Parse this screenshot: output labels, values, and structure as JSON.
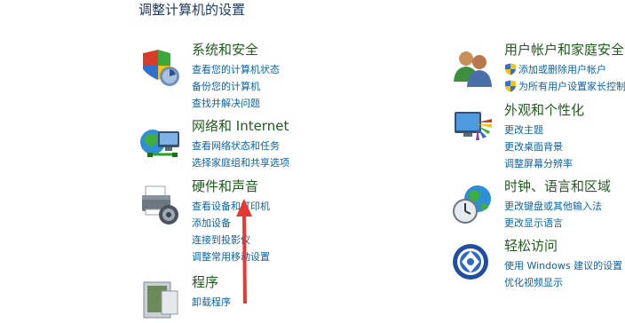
{
  "page": {
    "title": "调整计算机的设置"
  },
  "categories": [
    {
      "heading": "系统和安全",
      "links": [
        "查看您的计算机状态",
        "备份您的计算机",
        "查找并解决问题"
      ]
    },
    {
      "heading": "网络和 Internet",
      "links": [
        "查看网络状态和任务",
        "选择家庭组和共享选项"
      ]
    },
    {
      "heading": "硬件和声音",
      "links": [
        "查看设备和打印机",
        "添加设备",
        "连接到投影仪",
        "调整常用移动设置"
      ]
    },
    {
      "heading": "程序",
      "links": [
        "卸载程序"
      ]
    },
    {
      "heading": "用户帐户和家庭安全",
      "links": [
        "添加或删除用户帐户",
        "为所有用户设置家长控制"
      ]
    },
    {
      "heading": "外观和个性化",
      "links": [
        "更改主题",
        "更改桌面背景",
        "调整屏幕分辨率"
      ]
    },
    {
      "heading": "时钟、语言和区域",
      "links": [
        "更改键盘或其他输入法",
        "更改显示语言"
      ]
    },
    {
      "heading": "轻松访问",
      "links": [
        "使用 Windows 建议的设置",
        "优化视频显示"
      ]
    }
  ],
  "colors": {
    "heading": "#1e5d1e",
    "link": "#0a64a8",
    "annotation_arrow": "#e53935"
  }
}
